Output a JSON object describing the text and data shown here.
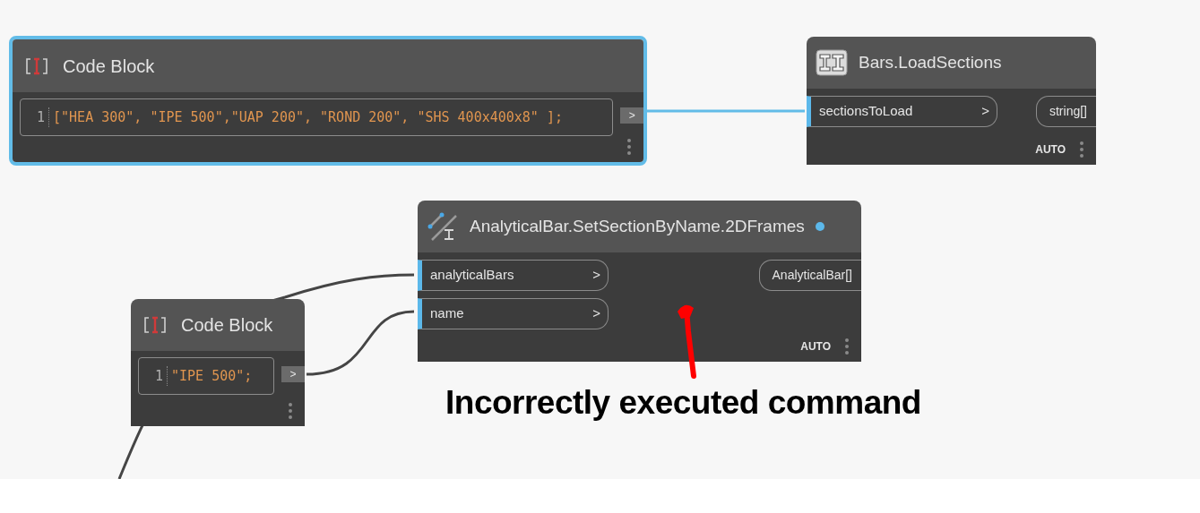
{
  "nodes": [
    {
      "kind": "code",
      "title": "Code Block",
      "selected": true,
      "line_number": "1",
      "code": "[\"HEA 300\", \"IPE 500\",\"UAP 200\", \"ROND 200\", \"SHS 400x400x8\" ];",
      "output": ">"
    },
    {
      "kind": "function",
      "title": "Bars.LoadSections",
      "selected": false,
      "status_dot": false,
      "inputs": [
        {
          "name": "sectionsToLoad",
          "arrow": ">"
        }
      ],
      "outputs": [
        "string[]"
      ],
      "lacing": "AUTO"
    },
    {
      "kind": "function",
      "title": "AnalyticalBar.SetSectionByName.2DFrames",
      "selected": false,
      "status_dot": true,
      "inputs": [
        {
          "name": "analyticalBars",
          "arrow": ">"
        },
        {
          "name": "name",
          "arrow": ">"
        }
      ],
      "outputs": [
        "AnalyticalBar[]"
      ],
      "lacing": "AUTO"
    },
    {
      "kind": "code",
      "title": "Code Block",
      "selected": false,
      "line_number": "1",
      "code": "\"IPE 500\";",
      "output": ">"
    }
  ],
  "annotation": "Incorrectly executed command"
}
